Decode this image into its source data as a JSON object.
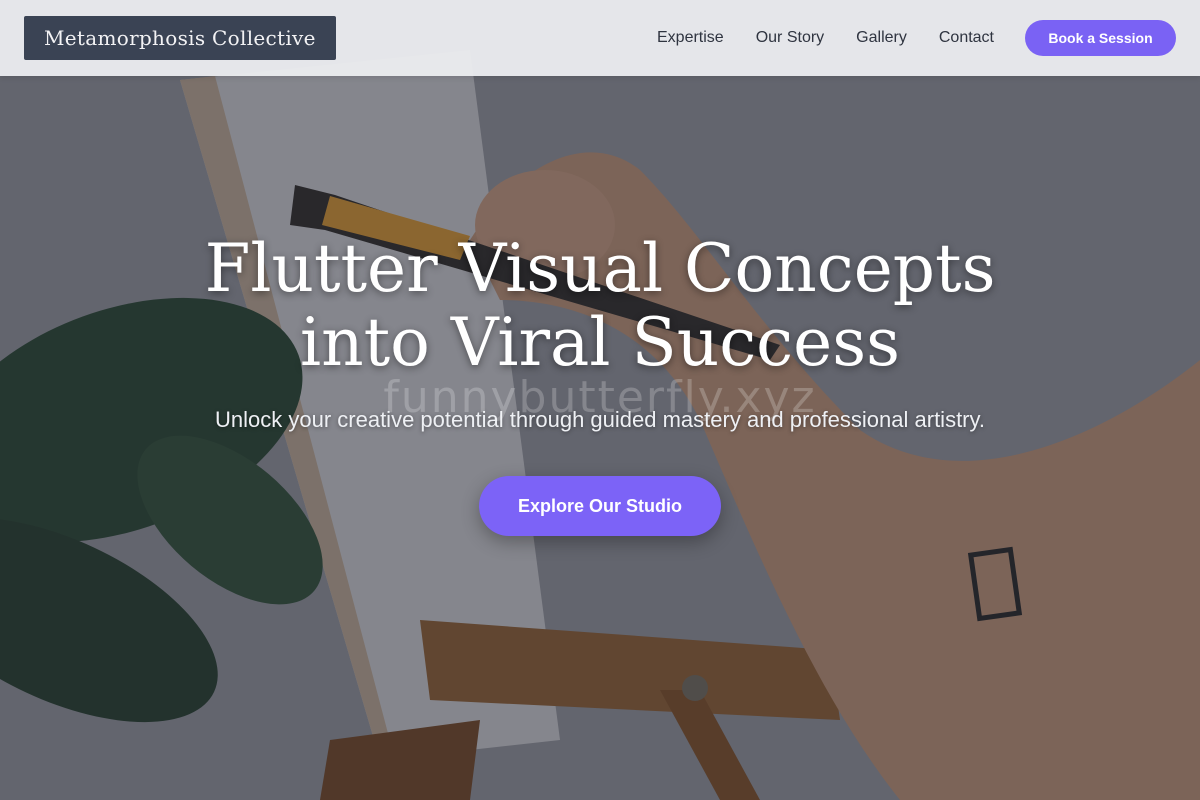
{
  "nav": {
    "logo": "Metamorphosis Collective",
    "links": [
      "Expertise",
      "Our Story",
      "Gallery",
      "Contact"
    ],
    "cta": "Book a Session"
  },
  "hero": {
    "headline_line1": "Flutter Visual Concepts",
    "headline_line2": "into Viral Success",
    "watermark": "funnybutterfly.xyz",
    "subtitle": "Unlock your creative potential through guided mastery and professional artistry.",
    "cta": "Explore Our Studio"
  },
  "colors": {
    "accent": "#7a62f4",
    "logo_bg": "#3a4354"
  }
}
